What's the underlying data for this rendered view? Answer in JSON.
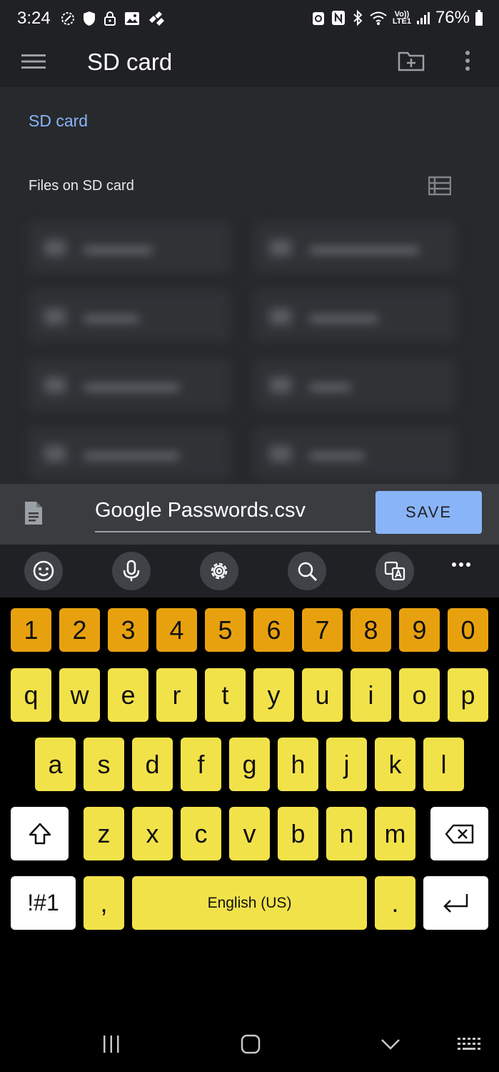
{
  "status_bar": {
    "time": "3:24",
    "battery_percent": "76%",
    "network_label_top": "Vo))",
    "network_label_bottom": "LTE1"
  },
  "app_bar": {
    "title": "SD card"
  },
  "content": {
    "breadcrumb": "SD card",
    "section_title": "Files on SD card"
  },
  "save_bar": {
    "filename": "Google Passwords.csv",
    "save_label": "SAVE"
  },
  "keyboard_toolbar": {
    "buttons": [
      "emoji-icon",
      "microphone-icon",
      "settings-icon",
      "search-icon",
      "translate-icon",
      "more-icon"
    ]
  },
  "keyboard": {
    "number_row": [
      "1",
      "2",
      "3",
      "4",
      "5",
      "6",
      "7",
      "8",
      "9",
      "0"
    ],
    "row1": [
      "q",
      "w",
      "e",
      "r",
      "t",
      "y",
      "u",
      "i",
      "o",
      "p"
    ],
    "row2": [
      "a",
      "s",
      "d",
      "f",
      "g",
      "h",
      "j",
      "k",
      "l"
    ],
    "row3": [
      "z",
      "x",
      "c",
      "v",
      "b",
      "n",
      "m"
    ],
    "symbols_label": "!#1",
    "comma_label": ",",
    "space_label": "English (US)",
    "period_label": "."
  },
  "colors": {
    "background": "#27292c",
    "app_bar": "#202124",
    "accent": "#8ab4f8",
    "key_yellow": "#f2e24a",
    "key_orange": "#e8a10e"
  }
}
